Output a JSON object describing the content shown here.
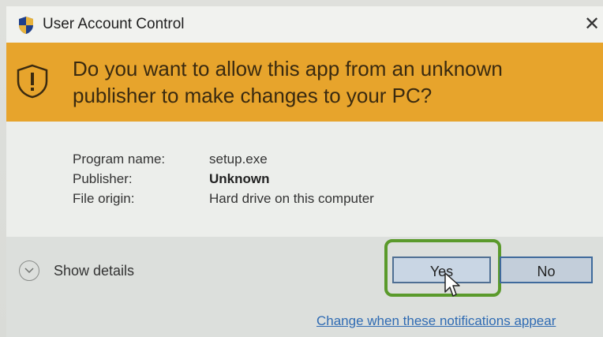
{
  "window": {
    "title": "User Account Control",
    "close_glyph": "✕"
  },
  "banner": {
    "question": "Do you want to allow this app from an unknown publisher to make changes to your PC?",
    "color": "#e7a42c",
    "icon": "warning-shield-icon"
  },
  "info": {
    "rows": [
      {
        "label": "Program name:",
        "value": "setup.exe"
      },
      {
        "label": "Publisher:",
        "value": "Unknown"
      },
      {
        "label": "File origin:",
        "value": "Hard drive on this computer"
      }
    ]
  },
  "footer": {
    "details_label": "Show details",
    "yes_label": "Yes",
    "no_label": "No",
    "highlight_color": "#5a9a2b",
    "link_text": "Change when these notifications appear"
  }
}
